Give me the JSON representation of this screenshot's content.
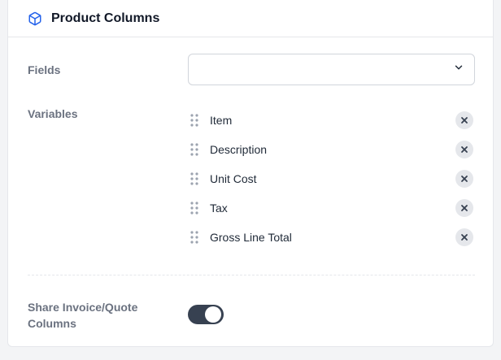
{
  "header": {
    "title": "Product Columns",
    "icon": "cube-icon",
    "accent": "#2563eb"
  },
  "fields": {
    "label": "Fields",
    "value": ""
  },
  "variables": {
    "label": "Variables",
    "items": [
      {
        "label": "Item"
      },
      {
        "label": "Description"
      },
      {
        "label": "Unit Cost"
      },
      {
        "label": "Tax"
      },
      {
        "label": "Gross Line Total"
      }
    ]
  },
  "share": {
    "label": "Share Invoice/Quote Columns",
    "enabled": true,
    "on_color": "#374151"
  }
}
